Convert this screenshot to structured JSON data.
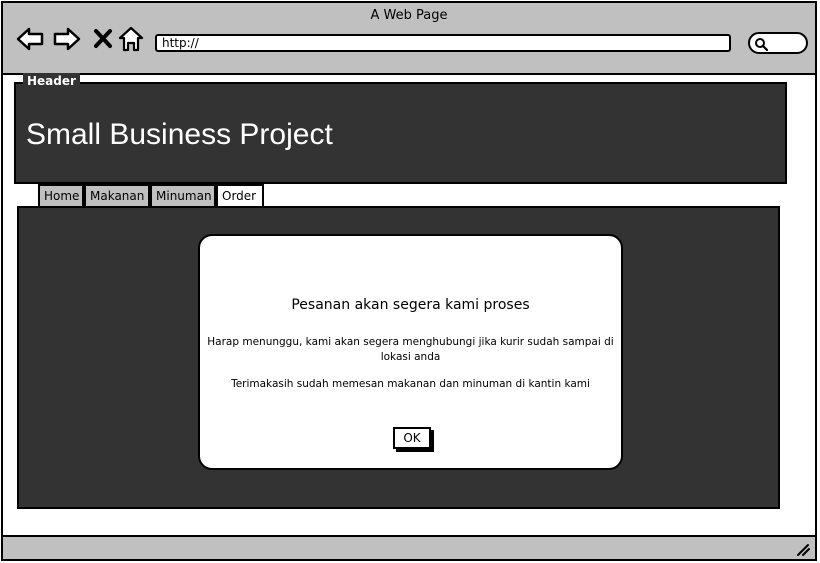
{
  "window": {
    "title": "A Web Page"
  },
  "browser": {
    "url": "http://",
    "icons": [
      "back-arrow-icon",
      "forward-arrow-icon",
      "close-x-icon",
      "home-icon",
      "search-icon"
    ]
  },
  "header": {
    "legend": "Header",
    "title": "Small Business Project"
  },
  "tabs": [
    {
      "label": "Home"
    },
    {
      "label": "Makanan"
    },
    {
      "label": "Minuman"
    },
    {
      "label": "Order",
      "active": true
    }
  ],
  "dialog": {
    "title": "Pesanan akan segera kami proses",
    "message1": "Harap menunggu, kami akan segera menghubungi jika kurir sudah sampai di lokasi anda",
    "message2": "Terimakasih sudah memesan makanan dan minuman di kantin kami",
    "ok_label": "OK"
  },
  "colors": {
    "chrome": "#c0c0c0",
    "panel": "#333333",
    "outline": "#000000",
    "dialog": "#ffffff"
  }
}
